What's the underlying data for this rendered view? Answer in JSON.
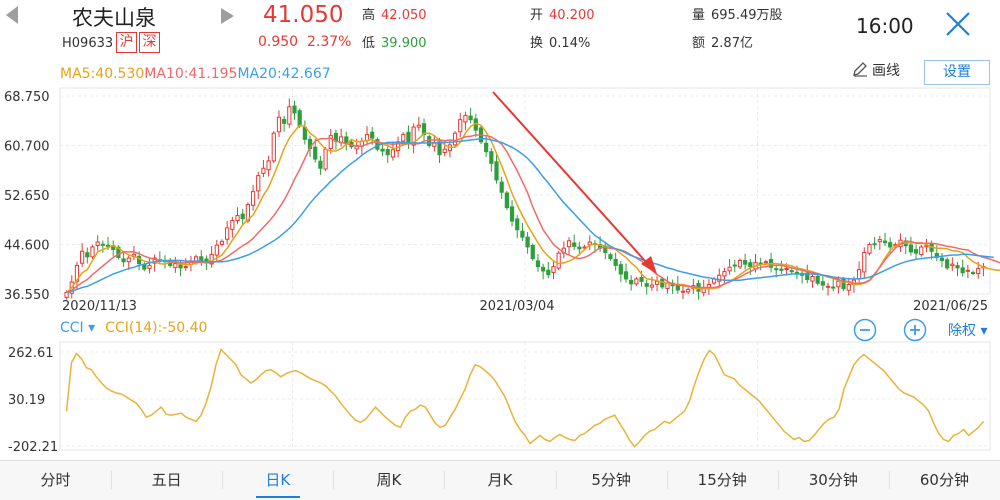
{
  "header": {
    "stock_name": "农夫山泉",
    "stock_code": "H09633",
    "tags": [
      "沪",
      "深"
    ],
    "price": "41.050",
    "change": "0.950",
    "change_pct": "2.37%",
    "high_label": "高",
    "high_value": "42.050",
    "low_label": "低",
    "low_value": "39.900",
    "open_label": "开",
    "open_value": "40.200",
    "turnover_label": "换",
    "turnover_value": "0.14%",
    "volume_label": "量",
    "volume_value": "695.49万股",
    "amount_label": "额",
    "amount_value": "2.87亿",
    "time": "16:00"
  },
  "toolbar": {
    "ma5": "MA5:40.530",
    "ma10": "MA10:41.195",
    "ma20": "MA20:42.667",
    "draw_label": "画线",
    "settings_label": "设置"
  },
  "indicator": {
    "name": "CCI",
    "value_label": "CCI(14):-50.40",
    "fuquan_label": "除权"
  },
  "tabs": [
    {
      "label": "分时",
      "active": false
    },
    {
      "label": "五日",
      "active": false
    },
    {
      "label": "日K",
      "active": true
    },
    {
      "label": "周K",
      "active": false
    },
    {
      "label": "月K",
      "active": false
    },
    {
      "label": "5分钟",
      "active": false
    },
    {
      "label": "15分钟",
      "active": false
    },
    {
      "label": "30分钟",
      "active": false
    },
    {
      "label": "60分钟",
      "active": false
    }
  ],
  "colors": {
    "up": "#e53935",
    "down": "#2e9e3d",
    "ma5": "#e8a317",
    "ma10": "#f06a6a",
    "ma20": "#3d9ee8",
    "cci": "#e8b33a",
    "accent": "#1f7fd6"
  },
  "chart_data": [
    {
      "type": "candlestick",
      "y_ticks": [
        "68.750",
        "60.700",
        "52.650",
        "44.600",
        "36.550"
      ],
      "ylim": [
        36.55,
        68.75
      ],
      "x_labels": [
        "2020/11/13",
        "2021/03/04",
        "2021/06/25"
      ],
      "grid": true,
      "annotation": "red arrow pointing down toward the trough",
      "close_series": [
        36.8,
        38.5,
        41.2,
        43.5,
        42.6,
        44.2,
        45.0,
        44.6,
        44.3,
        43.8,
        42.5,
        41.8,
        42.4,
        43.0,
        41.5,
        40.6,
        41.2,
        42.4,
        42.0,
        41.8,
        41.2,
        41.5,
        40.8,
        41.0,
        41.9,
        42.6,
        42.0,
        41.8,
        43.0,
        44.5,
        45.1,
        47.3,
        48.5,
        49.3,
        48.8,
        51.1,
        53.2,
        55.8,
        57.0,
        58.2,
        62.7,
        65.3,
        64.3,
        67.0,
        66.0,
        63.9,
        61.7,
        60.2,
        58.5,
        57.0,
        60.1,
        62.3,
        61.4,
        62.1,
        61.0,
        60.5,
        60.7,
        61.4,
        62.5,
        61.9,
        60.1,
        59.8,
        59.2,
        60.0,
        61.3,
        62.5,
        61.0,
        63.7,
        64.0,
        62.5,
        60.7,
        61.2,
        59.2,
        60.1,
        60.8,
        62.7,
        64.9,
        65.6,
        64.9,
        63.2,
        61.3,
        59.7,
        57.8,
        55.1,
        53.1,
        50.6,
        48.4,
        47.0,
        45.8,
        44.2,
        42.3,
        41.0,
        40.3,
        39.7,
        41.0,
        43.2,
        44.0,
        45.2,
        44.3,
        43.9,
        44.2,
        45.0,
        44.6,
        44.0,
        43.3,
        42.3,
        41.2,
        39.8,
        39.0,
        38.2,
        39.0,
        38.6,
        37.8,
        38.0,
        38.6,
        37.7,
        38.3,
        37.9,
        37.2,
        37.0,
        37.3,
        37.9,
        37.0,
        37.5,
        38.1,
        39.0,
        39.6,
        40.2,
        40.9,
        41.2,
        42.0,
        41.4,
        41.0,
        41.7,
        41.5,
        41.8,
        40.9,
        40.6,
        40.4,
        40.7,
        40.2,
        39.8,
        39.6,
        38.9,
        39.4,
        38.3,
        38.0,
        37.8,
        37.6,
        38.6,
        37.4,
        38.1,
        38.8,
        40.5,
        43.3,
        44.6,
        44.7,
        45.4,
        44.9,
        44.2,
        44.6,
        45.3,
        44.4,
        43.4,
        43.2,
        44.2,
        44.4,
        43.5,
        42.5,
        42.0,
        40.8,
        41.4,
        40.8,
        40.0,
        40.4,
        40.0,
        40.7,
        41.0
      ],
      "series": [
        {
          "name": "MA5",
          "values": [
            36.8,
            37.6,
            38.8,
            40.0,
            40.5,
            42.0,
            43.4,
            43.8,
            44.1,
            44.4,
            44.0,
            43.4,
            42.9,
            42.7,
            42.3,
            41.9,
            41.7,
            41.7,
            41.5,
            41.4,
            41.7,
            41.7,
            41.4,
            41.3,
            41.3,
            41.6,
            41.7,
            41.8,
            41.9,
            42.4,
            42.9,
            44.0,
            45.3,
            46.5,
            47.8,
            48.6,
            49.4,
            50.9,
            52.6,
            53.9,
            55.9,
            58.0,
            60.2,
            61.9,
            63.0,
            64.0,
            63.8,
            62.7,
            62.1,
            61.0,
            60.1,
            59.8,
            59.8,
            60.2,
            60.9,
            61.7,
            61.3,
            61.4,
            61.5,
            61.7,
            61.2,
            60.9,
            60.7,
            60.2,
            60.4,
            60.8,
            61.0,
            61.2,
            61.8,
            62.7,
            62.7,
            62.3,
            61.6,
            60.8,
            60.4,
            60.4,
            61.2,
            62.7,
            63.8,
            64.3,
            64.0,
            62.9,
            61.4,
            59.4,
            57.4,
            55.2,
            52.9,
            51.0,
            49.3,
            47.7,
            46.3,
            44.9,
            43.6,
            42.7,
            41.9,
            41.5,
            41.6,
            41.9,
            42.3,
            43.0,
            43.8,
            44.5,
            44.7,
            44.5,
            44.4,
            44.2,
            43.8,
            43.1,
            42.5,
            41.6,
            40.9,
            39.8,
            39.0,
            38.9,
            38.7,
            38.5,
            38.3,
            38.2,
            38.1,
            38.1,
            37.9,
            37.5,
            37.4,
            37.4,
            37.4,
            37.5,
            37.6,
            38.2,
            38.6,
            39.1,
            39.7,
            40.3,
            40.8,
            41.1,
            41.3,
            41.4,
            41.5,
            41.5,
            41.4,
            41.3,
            41.1,
            40.8,
            40.6,
            40.4,
            40.2,
            39.8,
            39.6,
            39.3,
            39.1,
            38.7,
            38.5,
            38.5,
            38.1,
            38.1,
            38.3,
            38.7,
            39.6,
            41.0,
            42.4,
            43.6,
            44.4,
            44.8,
            44.8,
            44.9,
            44.9,
            44.9,
            44.6,
            44.2,
            44.0,
            44.0,
            43.9,
            43.6,
            43.5,
            43.3,
            42.5,
            41.8,
            41.4,
            40.9,
            40.7,
            40.5,
            40.4,
            40.4
          ]
        },
        {
          "name": "MA10",
          "values": [
            36.8,
            37.2,
            37.8,
            38.4,
            38.9,
            39.7,
            40.4,
            41.1,
            41.8,
            42.5,
            43.0,
            43.4,
            43.4,
            43.4,
            43.1,
            42.7,
            42.4,
            42.2,
            42.1,
            41.9,
            41.8,
            41.8,
            41.6,
            41.6,
            41.7,
            41.7,
            41.7,
            41.6,
            41.6,
            41.8,
            42.1,
            42.6,
            43.2,
            43.8,
            44.4,
            44.9,
            45.6,
            46.5,
            47.4,
            48.3,
            49.3,
            50.5,
            51.8,
            53.4,
            55.2,
            56.8,
            58.6,
            60.4,
            61.4,
            61.8,
            61.8,
            61.9,
            61.4,
            61.2,
            61.0,
            60.8,
            60.6,
            60.6,
            60.9,
            61.2,
            61.3,
            61.1,
            61.0,
            60.9,
            61.0,
            61.0,
            61.0,
            61.0,
            61.0,
            61.4,
            61.6,
            61.6,
            61.6,
            61.5,
            61.6,
            61.5,
            61.8,
            62.1,
            62.2,
            62.4,
            62.4,
            62.3,
            62.1,
            61.6,
            60.9,
            59.7,
            58.1,
            56.6,
            54.8,
            53.0,
            50.7,
            48.8,
            47.0,
            45.8,
            44.6,
            43.9,
            43.3,
            42.9,
            42.5,
            42.3,
            42.5,
            42.9,
            43.5,
            44.1,
            44.1,
            44.0,
            43.9,
            43.7,
            43.4,
            42.9,
            42.4,
            41.9,
            41.2,
            40.4,
            39.7,
            39.2,
            38.6,
            38.2,
            38.0,
            37.9,
            37.8,
            37.7,
            37.6,
            37.6,
            37.6,
            37.6,
            37.8,
            38.2,
            38.5,
            38.9,
            39.3,
            39.8,
            40.2,
            40.6,
            40.9,
            41.0,
            41.2,
            41.2,
            41.2,
            41.0,
            40.8,
            40.6,
            40.4,
            40.2,
            40.0,
            39.9,
            39.6,
            39.4,
            39.2,
            38.9,
            38.6,
            38.6,
            38.3,
            38.3,
            38.4,
            38.8,
            39.8,
            40.9,
            42.1,
            43.1,
            44.0,
            44.7,
            45.1,
            45.1,
            44.8,
            44.8,
            44.8,
            44.8,
            44.7,
            44.5,
            44.3,
            44.2,
            44.0,
            43.8,
            43.7,
            43.2,
            42.8,
            42.5,
            42.3,
            42.0,
            41.7,
            41.3
          ]
        },
        {
          "name": "MA20",
          "values": [
            36.8,
            37.0,
            37.3,
            37.6,
            37.8,
            38.2,
            38.6,
            39.0,
            39.4,
            39.8,
            40.1,
            40.4,
            40.7,
            40.9,
            41.2,
            41.4,
            41.6,
            41.8,
            41.9,
            42.0,
            42.0,
            42.0,
            42.0,
            41.9,
            41.9,
            41.9,
            41.9,
            41.8,
            41.8,
            41.8,
            41.8,
            41.9,
            42.1,
            42.3,
            42.6,
            42.9,
            43.3,
            43.7,
            44.2,
            44.7,
            45.2,
            45.8,
            46.5,
            47.2,
            48.1,
            49.1,
            50.2,
            51.3,
            52.3,
            53.2,
            54.0,
            54.9,
            55.6,
            56.4,
            57.1,
            57.8,
            58.4,
            59.1,
            59.7,
            60.2,
            60.7,
            61.0,
            61.2,
            61.2,
            61.2,
            61.2,
            61.1,
            61.1,
            61.1,
            61.1,
            61.1,
            61.1,
            61.2,
            61.2,
            61.2,
            61.3,
            61.4,
            61.5,
            61.6,
            61.7,
            61.8,
            61.8,
            61.6,
            61.4,
            61.2,
            60.8,
            60.4,
            59.9,
            59.3,
            58.6,
            57.7,
            56.7,
            55.6,
            54.6,
            53.5,
            52.4,
            51.4,
            50.5,
            49.6,
            48.7,
            47.8,
            46.9,
            46.1,
            45.5,
            44.9,
            44.3,
            43.9,
            43.6,
            43.2,
            42.8,
            42.5,
            42.2,
            41.9,
            41.6,
            41.4,
            41.1,
            40.8,
            40.6,
            40.3,
            40.1,
            39.9,
            39.7,
            39.5,
            39.3,
            39.2,
            39.0,
            38.9,
            38.8,
            38.8,
            38.8,
            38.8,
            38.9,
            39.0,
            39.1,
            39.2,
            39.3,
            39.4,
            39.5,
            39.6,
            39.7,
            39.8,
            39.8,
            39.8,
            39.8,
            39.8,
            39.7,
            39.6,
            39.5,
            39.3,
            39.2,
            39.1,
            39.0,
            39.0,
            39.0,
            39.1,
            39.3,
            39.6,
            40.0,
            40.4,
            40.8,
            41.2,
            41.5,
            41.8,
            42.0,
            42.2,
            42.3,
            42.4,
            42.5,
            42.6,
            42.7,
            42.8,
            42.9,
            42.9,
            43.0,
            43.0,
            42.9,
            42.8,
            42.7,
            42.6,
            42.5
          ]
        }
      ]
    },
    {
      "type": "line",
      "y_ticks": [
        "262.61",
        "30.19",
        "-202.21"
      ],
      "ylim": [
        -202.21,
        262.61
      ],
      "grid": true,
      "series": [
        {
          "name": "CCI(14)",
          "values": [
            -30,
            210,
            255,
            230,
            185,
            175,
            140,
            110,
            85,
            70,
            60,
            55,
            40,
            25,
            10,
            -20,
            -60,
            -50,
            -30,
            -10,
            -45,
            -50,
            -45,
            -40,
            -60,
            -70,
            -80,
            -50,
            10,
            90,
            200,
            275,
            250,
            225,
            200,
            150,
            130,
            110,
            125,
            150,
            170,
            175,
            160,
            140,
            155,
            165,
            170,
            160,
            145,
            130,
            120,
            110,
            95,
            70,
            45,
            10,
            -20,
            -50,
            -75,
            -85,
            -70,
            -40,
            -10,
            -35,
            -60,
            -80,
            -100,
            -110,
            -60,
            -30,
            -20,
            0,
            -10,
            -50,
            -90,
            -110,
            -100,
            -60,
            -20,
            30,
            80,
            150,
            200,
            190,
            170,
            150,
            120,
            80,
            40,
            -20,
            -80,
            -120,
            -150,
            -190,
            -170,
            -150,
            -170,
            -180,
            -160,
            -145,
            -160,
            -170,
            -175,
            -150,
            -140,
            -120,
            -100,
            -90,
            -70,
            -60,
            -50,
            -90,
            -130,
            -175,
            -205,
            -180,
            -150,
            -130,
            -120,
            -100,
            -80,
            -90,
            -70,
            -50,
            -30,
            20,
            100,
            170,
            230,
            270,
            250,
            200,
            150,
            140,
            130,
            100,
            80,
            60,
            40,
            20,
            -10,
            -40,
            -70,
            -100,
            -130,
            -150,
            -170,
            -160,
            -180,
            -175,
            -150,
            -120,
            -90,
            -70,
            -60,
            -20,
            80,
            140,
            200,
            230,
            250,
            230,
            210,
            190,
            170,
            140,
            110,
            80,
            60,
            50,
            40,
            20,
            0,
            -30,
            -90,
            -140,
            -170,
            -180,
            -150,
            -140,
            -120,
            -150,
            -130,
            -110,
            -80
          ]
        }
      ]
    }
  ]
}
